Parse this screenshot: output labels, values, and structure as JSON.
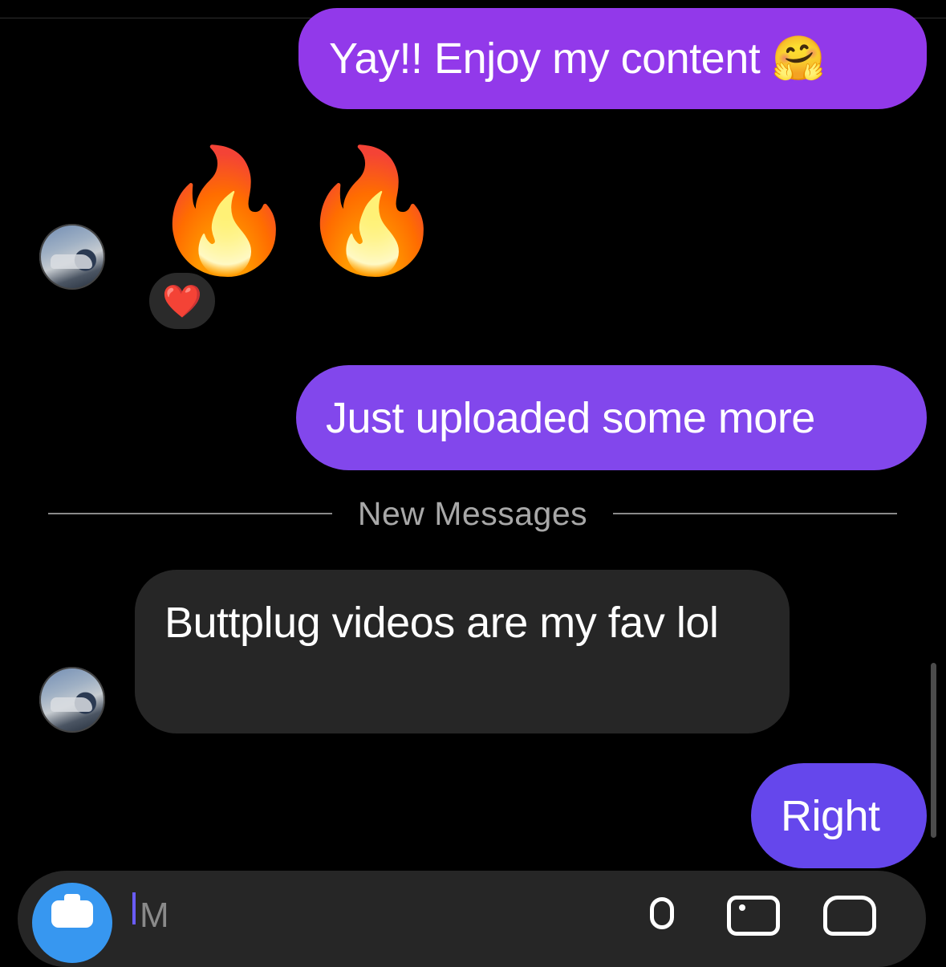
{
  "messages": {
    "outgoing_1": "Yay!! Enjoy my content 🤗",
    "incoming_emoji_1": "🔥",
    "incoming_emoji_2": "🔥",
    "reaction": "❤️",
    "outgoing_2": "Just uploaded some more",
    "incoming_text": "Buttplug videos are my fav lol",
    "outgoing_3": "Right"
  },
  "divider": {
    "label": "New Messages"
  },
  "composer": {
    "placeholder": "M"
  },
  "colors": {
    "outgoing_1": "#9239ea",
    "outgoing_2": "#8247ec",
    "outgoing_3": "#6547ec",
    "incoming": "#262626",
    "camera_button": "#3797f0"
  },
  "icons": {
    "camera": "camera-icon",
    "mic": "microphone-icon",
    "gallery": "gallery-icon",
    "sticker": "sticker-icon"
  }
}
